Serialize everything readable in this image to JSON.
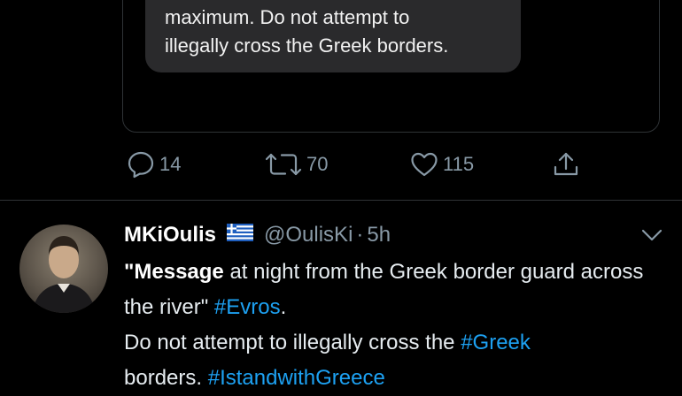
{
  "quoted": {
    "line1": "maximum. Do not attempt to",
    "line2": "illegally cross the Greek borders."
  },
  "actions": {
    "reply_count": "14",
    "retweet_count": "70",
    "like_count": "115"
  },
  "tweet": {
    "name": "MKiOulis",
    "handle": "@OulisKi",
    "separator": "·",
    "time": "5h",
    "text_part1_bold": "\"Message",
    "text_part2": " at night from the Greek border guard across the river\" ",
    "hashtag_evros": "#Evros",
    "text_part3": ".",
    "text_part4": "Do not attempt to illegally cross the ",
    "hashtag_greek": "#Greek",
    "text_part5": "borders. ",
    "hashtag_istand": "#IstandwithGreece"
  },
  "colors": {
    "background": "#000000",
    "muted": "#8899a6",
    "link": "#1da1f2",
    "bubble": "#2a2a2c"
  },
  "icons": {
    "reply": "reply-icon",
    "retweet": "retweet-icon",
    "like": "heart-icon",
    "share": "share-icon",
    "flag": "greece-flag-icon",
    "more": "chevron-down-icon"
  }
}
